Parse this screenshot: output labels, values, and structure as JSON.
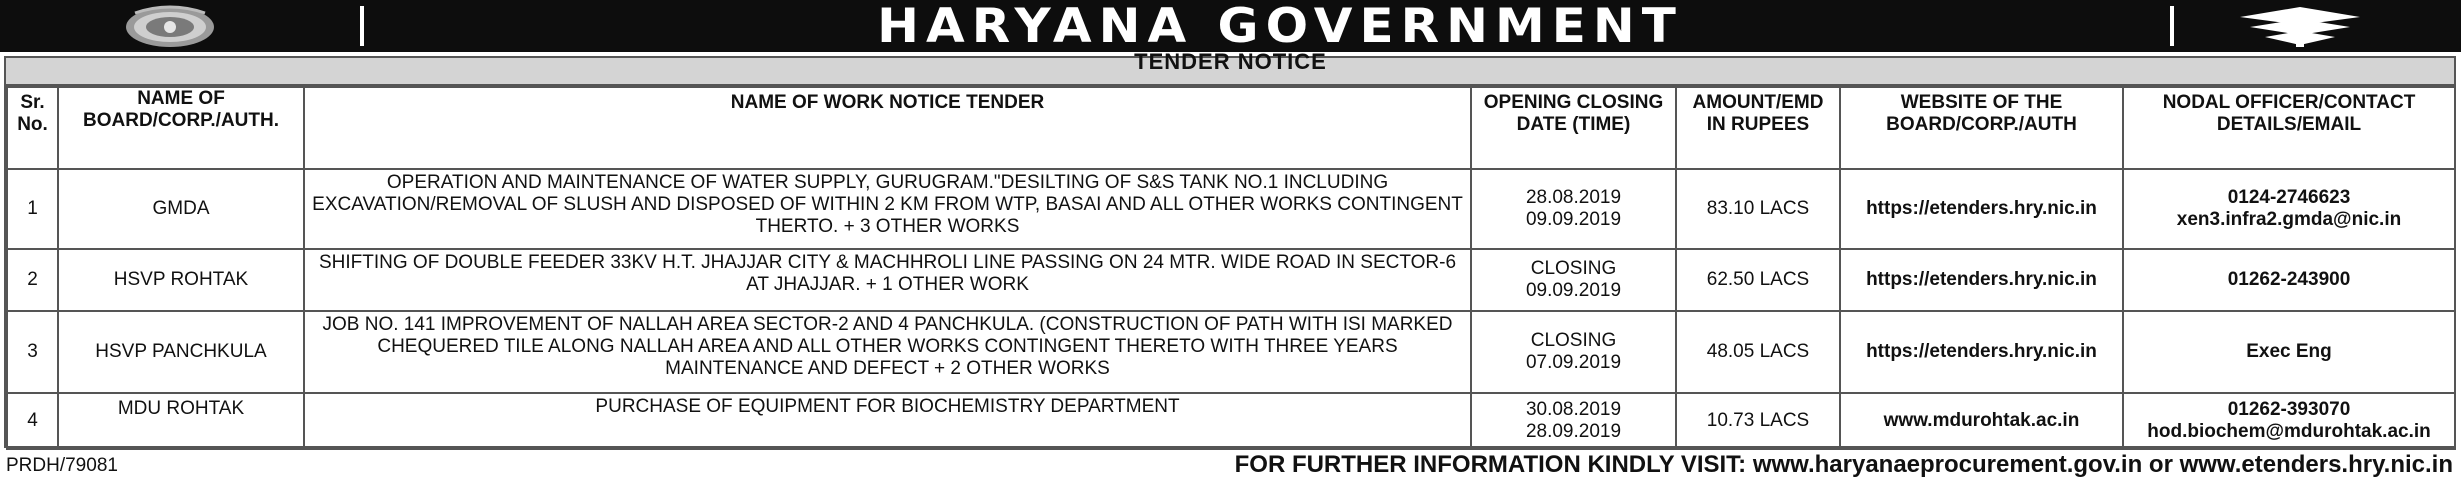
{
  "banner": {
    "title": "HARYANA GOVERNMENT",
    "left_icon": "state-emblem-icon",
    "right_icon": "prdh-logo-icon"
  },
  "notice_title": "TENDER NOTICE",
  "columns": {
    "sr": "Sr. No.",
    "board": "NAME OF BOARD/CORP./AUTH.",
    "work": "NAME OF WORK NOTICE TENDER",
    "dates": "OPENING CLOSING DATE (TIME)",
    "amount": "AMOUNT/EMD IN RUPEES",
    "website": "WEBSITE  OF THE BOARD/CORP./AUTH",
    "contact": "NODAL OFFICER/CONTACT DETAILS/EMAIL"
  },
  "rows": [
    {
      "sr": "1",
      "board": "GMDA",
      "work": "OPERATION AND MAINTENANCE OF WATER SUPPLY, GURUGRAM.\"DESILTING OF S&S TANK NO.1 INCLUDING EXCAVATION/REMOVAL OF SLUSH AND DISPOSED OF WITHIN 2 KM FROM WTP, BASAI AND ALL OTHER WORKS CONTINGENT THERTO. + 3 OTHER WORKS",
      "date_line1": "28.08.2019",
      "date_line2": "09.09.2019",
      "amount": "83.10 LACS",
      "website": "https://etenders.hry.nic.in",
      "contact_line1": "0124-2746623",
      "contact_line2": "xen3.infra2.gmda@nic.in"
    },
    {
      "sr": "2",
      "board": "HSVP ROHTAK",
      "work": "SHIFTING OF DOUBLE FEEDER 33KV H.T. JHAJJAR CITY & MACHHROLI LINE PASSING ON 24 MTR. WIDE ROAD IN SECTOR-6 AT JHAJJAR. + 1 OTHER WORK",
      "date_line1": "CLOSING",
      "date_line2": "09.09.2019",
      "amount": "62.50 LACS",
      "website": "https://etenders.hry.nic.in",
      "contact_line1": "01262-243900",
      "contact_line2": ""
    },
    {
      "sr": "3",
      "board": "HSVP PANCHKULA",
      "work": "JOB NO. 141 IMPROVEMENT OF NALLAH AREA SECTOR-2 AND 4 PANCHKULA. (CONSTRUCTION OF PATH WITH ISI MARKED CHEQUERED TILE ALONG NALLAH AREA AND ALL OTHER WORKS CONTINGENT THERETO WITH THREE YEARS MAINTENANCE AND DEFECT + 2 OTHER WORKS",
      "date_line1": "CLOSING",
      "date_line2": "07.09.2019",
      "amount": "48.05 LACS",
      "website": "https://etenders.hry.nic.in",
      "contact_line1": "Exec Eng",
      "contact_line2": ""
    },
    {
      "sr": "4",
      "board": "MDU ROHTAK",
      "work": "PURCHASE OF EQUIPMENT FOR BIOCHEMISTRY DEPARTMENT",
      "date_line1": "30.08.2019",
      "date_line2": "28.09.2019",
      "amount": "10.73 LACS",
      "website": "www.mdurohtak.ac.in",
      "contact_line1": "01262-393070",
      "contact_line2": "hod.biochem@mdurohtak.ac.in"
    }
  ],
  "footer": {
    "ref": "PRDH/79081",
    "info": "FOR FURTHER INFORMATION KINDLY VISIT: www.haryanaeprocurement.gov.in or www.etenders.hry.nic.in"
  }
}
